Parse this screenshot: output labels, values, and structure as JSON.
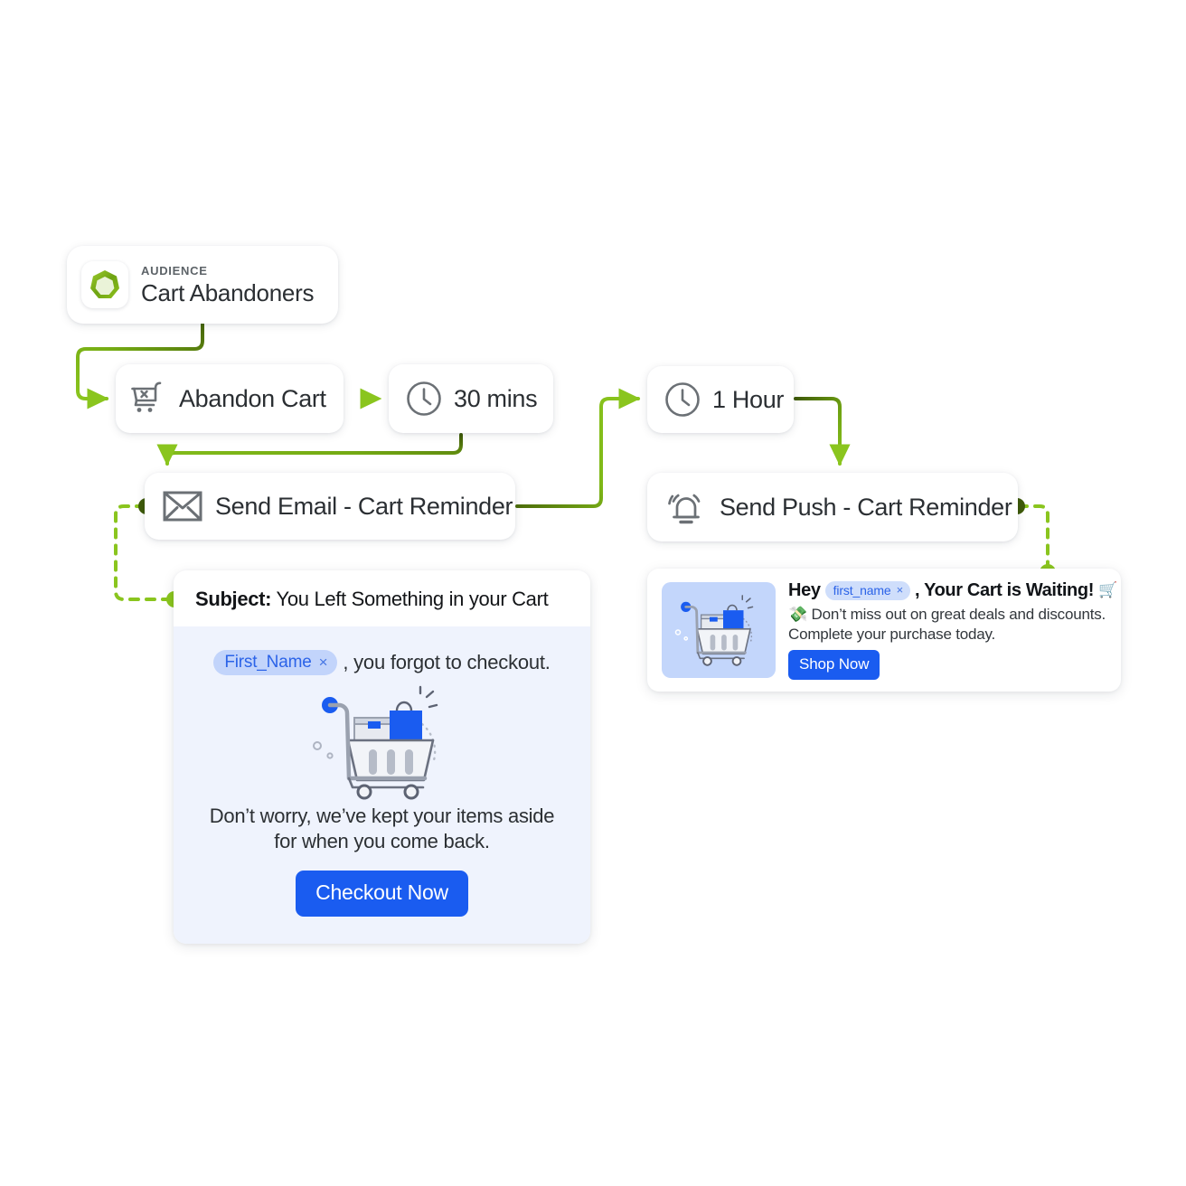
{
  "colors": {
    "wire_light": "#8ac51e",
    "wire_dark": "#49680a",
    "dot_dark": "#3f5b0a",
    "dot_light": "#8ac51e",
    "accent_blue": "#1a5cf0",
    "chip_bg": "#c2d4fb",
    "chip_text": "#2b63e8",
    "email_body_bg": "#eff3fd",
    "push_thumb_bg": "#c3d6fb",
    "node_text": "#2b2f33",
    "icon_gray": "#6b7075"
  },
  "audience": {
    "kicker": "AUDIENCE",
    "title": "Cart Abandoners",
    "icon": "audience-gem-icon"
  },
  "nodes": {
    "abandon_cart": {
      "label": "Abandon Cart",
      "icon": "cart-x-icon"
    },
    "delay_30": {
      "label": "30 mins",
      "icon": "clock-icon"
    },
    "delay_1h": {
      "label": "1 Hour",
      "icon": "clock-icon"
    },
    "send_email": {
      "label": "Send Email - Cart Reminder",
      "icon": "envelope-icon"
    },
    "send_push": {
      "label": "Send Push - Cart Reminder",
      "icon": "alarm-bell-icon"
    }
  },
  "email_preview": {
    "subject_label": "Subject:",
    "subject_text": "You Left Something in your Cart",
    "chip_label": "First_Name",
    "chip_remove": "×",
    "greeting_rest": ", you forgot to checkout.",
    "illustration": "abandoned-shopping-cart-illustration",
    "body_copy": "Don’t worry, we’ve kept your items aside for when you come back.",
    "cta_label": "Checkout Now"
  },
  "push_preview": {
    "thumb": "abandoned-shopping-cart-illustration",
    "title_prefix": "Hey",
    "chip_label": "first_name",
    "chip_remove": "×",
    "title_suffix": ", Your Cart is Waiting!",
    "title_emoji": "🛒",
    "body_emoji": "💸",
    "body_line1": "Don’t miss out on great deals and discounts.",
    "body_line2": "Complete your purchase today.",
    "cta_label": "Shop Now"
  }
}
